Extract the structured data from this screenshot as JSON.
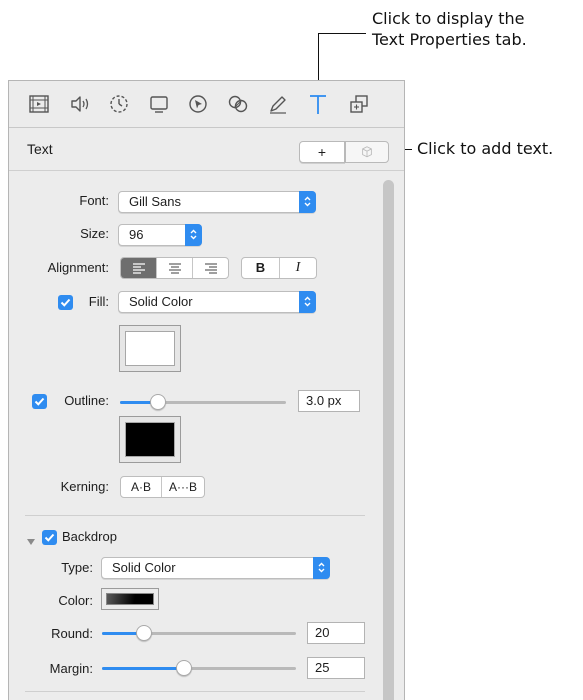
{
  "callouts": {
    "text_tab_line1": "Click to display the",
    "text_tab_line2": "Text Properties tab.",
    "add_text": "Click to add text."
  },
  "toolbar": {
    "icons": [
      "movie-icon",
      "audio-icon",
      "timer-icon",
      "screen-icon",
      "cursor-icon",
      "filters-icon",
      "pencil-icon",
      "text-icon",
      "layers-icon"
    ],
    "selected": "text-icon",
    "accent_color": "#2f8cf0"
  },
  "text_panel": {
    "title": "Text",
    "add_button": "+"
  },
  "properties": {
    "font_label": "Font:",
    "font_value": "Gill Sans",
    "size_label": "Size:",
    "size_value": "96",
    "alignment_label": "Alignment:",
    "alignment_selected": "left",
    "bold_label": "B",
    "italic_label": "I",
    "fill_label": "Fill:",
    "fill_checked": true,
    "fill_value": "Solid Color",
    "fill_color": "#ffffff",
    "outline_label": "Outline:",
    "outline_checked": true,
    "outline_slider_level": 0.2,
    "outline_value": "3.0 px",
    "outline_color": "#000000",
    "kerning_label": "Kerning:",
    "kerning_tighter": "A·B",
    "kerning_looser": "A···B"
  },
  "backdrop": {
    "title": "Backdrop",
    "checked": true,
    "type_label": "Type:",
    "type_value": "Solid Color",
    "color_label": "Color:",
    "round_label": "Round:",
    "round_slider_level": 0.2,
    "round_value": "20",
    "margin_label": "Margin:",
    "margin_slider_level": 0.42,
    "margin_value": "25"
  }
}
